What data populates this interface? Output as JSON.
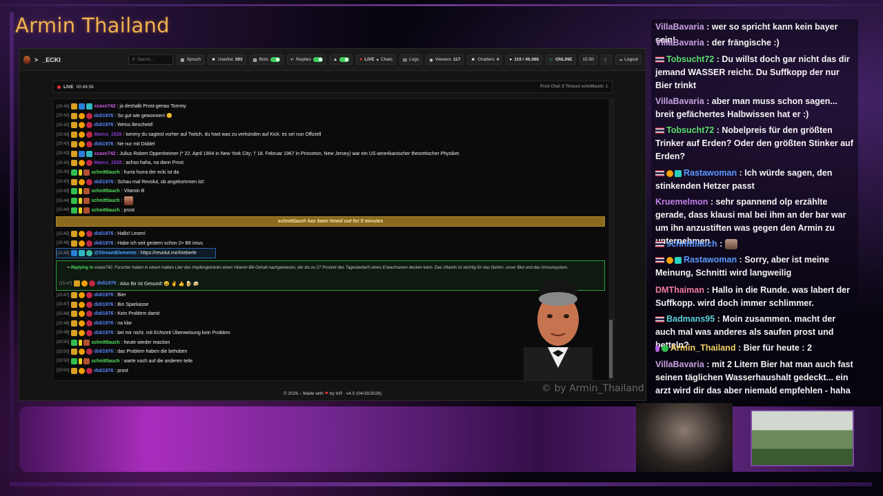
{
  "overlay": {
    "channel_title": "Armin Thailand",
    "watermark": "© by Armin_Thailand"
  },
  "app": {
    "brand": "_ECKI",
    "search_placeholder": "Search...",
    "toolbar": {
      "spruch": "Spruch",
      "userlist": "Userlist",
      "userlist_count": "393",
      "bots": "Bots",
      "replies": "Replies",
      "live": "LIVE",
      "chats": "Chats",
      "logs": "Logs",
      "viewers": "Viewers",
      "viewers_count": "117",
      "chatters": "Chatters",
      "chatters_count": "4",
      "messages": "119 / 46.986",
      "online": "ONLINE",
      "time": "15:50",
      "logout": "Logout"
    },
    "status": {
      "live": "LIVE",
      "duration": "00:49:58",
      "right": "Prost Chat: 8  Timeout schnittlauch: 1"
    },
    "footer": {
      "before": "© 2026 – Made with",
      "after": "by tcR · v4.0 (04/16/2026)"
    }
  },
  "chat": {
    "messages": [
      {
        "ts": "[15:40]",
        "user": "xxaxe742",
        "cls": "u-xx",
        "badges": [
          "b-crown",
          "b-blue",
          "b-cyan"
        ],
        "text": ": ja deshalb Prost-genau Tommy"
      },
      {
        "ts": "[15:42]",
        "user": "didi1976",
        "cls": "u-didi",
        "badges": [
          "b-crown",
          "b-coin",
          "b-flower"
        ],
        "text": ": So gut wie gewonnen! 😊"
      },
      {
        "ts": "[15:42]",
        "user": "didi1976",
        "cls": "u-didi",
        "badges": [
          "b-crown",
          "b-coin",
          "b-flower"
        ],
        "text": ": Weiss Bescheid!"
      },
      {
        "ts": "[15:43]",
        "user": "Marco_1928",
        "cls": "u-marco",
        "badges": [
          "b-crown",
          "b-coin",
          "b-flower"
        ],
        "text": ": tommy du sagtest vorher auf Twitch, du hast was zu verkünden auf Kick. es sei nun Offiziell"
      },
      {
        "ts": "[15:43]",
        "user": "didi1976",
        "cls": "u-didi",
        "badges": [
          "b-crown",
          "b-coin",
          "b-flower"
        ],
        "text": ": Ne nur mit Diddel"
      },
      {
        "ts": "[15:43]",
        "user": "xxaxe742",
        "cls": "u-xx",
        "badges": [
          "b-crown",
          "b-blue",
          "b-cyan"
        ],
        "text": ": Julius Robert Oppenheimer (* 22. April 1904 in New York City; † 18. Februar 1967 in Princeton, New Jersey) war ein US-amerikanischer theoretischer Physiker."
      },
      {
        "ts": "[15:43]",
        "user": "Marco_1928",
        "cls": "u-marco",
        "badges": [
          "b-crown",
          "b-coin",
          "b-flower"
        ],
        "text": ": achso haha, na dann Prost"
      },
      {
        "ts": "[15:43]",
        "user": "schnittlauch",
        "cls": "u-schnitt",
        "badges": [
          "b-green",
          "b-yellow",
          "b-bear"
        ],
        "text": ": hurra hurra der ecki ist da"
      },
      {
        "ts": "[15:43]",
        "user": "didi1976",
        "cls": "u-didi",
        "badges": [
          "b-crown",
          "b-coin",
          "b-flower"
        ],
        "text": ": Schau mal Revolut, ob angekommen ist!"
      },
      {
        "ts": "[15:43]",
        "user": "schnittlauch",
        "cls": "u-schnitt",
        "badges": [
          "b-green",
          "b-yellow",
          "b-bear"
        ],
        "text": ": Vitamin B"
      },
      {
        "ts": "[15:44]",
        "user": "schnittlauch",
        "cls": "u-schnitt",
        "badges": [
          "b-green",
          "b-yellow",
          "b-bear"
        ],
        "text": ":",
        "emote": true
      },
      {
        "ts": "[15:44]",
        "user": "schnittlauch",
        "cls": "u-schnitt",
        "badges": [
          "b-green",
          "b-yellow",
          "b-bear"
        ],
        "text": ": prost"
      }
    ],
    "timeout_notice": "schnittlauch has been timed out for 5 minutes",
    "messages2": [
      {
        "ts": "[15:45]",
        "user": "didi1976",
        "cls": "u-didi",
        "badges": [
          "b-crown",
          "b-coin",
          "b-flower"
        ],
        "text": ": Hallo! Lesen!"
      },
      {
        "ts": "[15:46]",
        "user": "didi1976",
        "cls": "u-didi",
        "badges": [
          "b-crown",
          "b-coin",
          "b-flower"
        ],
        "text": ": Habe ich seit gestern schon 2× B6 intus."
      }
    ],
    "streamelements": {
      "ts": "[15:46]",
      "user": "@StreamElements",
      "text": ": https://revolut.me/trieberle"
    },
    "reply": {
      "label": "Replying to",
      "to": "xxaxe742:",
      "quote": "Forscher haben in einem halben Liter des Hopfengetränks einen Vitamin-B6-Gehalt nachgewiesen, der bis zu 27 Prozent des Tagesbedarfs eines Erwachsenen decken kann. Das Vitamin ist wichtig für das Gehirn, unser Blut und das Immunsystem.",
      "ts": "[15:47]",
      "user": "didi1976",
      "text": ": Also Bir ist Gesund! 😆 ✌ 👍 🍺 🍻"
    },
    "messages3": [
      {
        "ts": "[15:47]",
        "user": "didi1976",
        "cls": "u-didi",
        "badges": [
          "b-crown",
          "b-coin",
          "b-flower"
        ],
        "text": ": Bier"
      },
      {
        "ts": "[15:47]",
        "user": "didi1976",
        "cls": "u-didi",
        "badges": [
          "b-crown",
          "b-coin",
          "b-flower"
        ],
        "text": ": Bin Sparkasse"
      },
      {
        "ts": "[15:48]",
        "user": "didi1976",
        "cls": "u-didi",
        "badges": [
          "b-crown",
          "b-coin",
          "b-flower"
        ],
        "text": ": Kein Problem damit"
      },
      {
        "ts": "[15:49]",
        "user": "didi1976",
        "cls": "u-didi",
        "badges": [
          "b-crown",
          "b-coin",
          "b-flower"
        ],
        "text": ": na klar"
      },
      {
        "ts": "[15:49]",
        "user": "didi1976",
        "cls": "u-didi",
        "badges": [
          "b-crown",
          "b-coin",
          "b-flower"
        ],
        "text": ": bei mir nicht. mit Echtzeit Überweisung kein Problem"
      },
      {
        "ts": "[15:50]",
        "user": "schnittlauch",
        "cls": "u-schnitt",
        "badges": [
          "b-green",
          "b-yellow",
          "b-bear"
        ],
        "text": ": heute wieder reaction"
      },
      {
        "ts": "[15:50]",
        "user": "didi1976",
        "cls": "u-didi",
        "badges": [
          "b-crown",
          "b-coin",
          "b-flower"
        ],
        "text": ": das Problem haben die behoben"
      },
      {
        "ts": "[15:50]",
        "user": "schnittlauch",
        "cls": "u-schnitt",
        "badges": [
          "b-green",
          "b-yellow",
          "b-bear"
        ],
        "text": ": warte noch auf die anderen teile"
      },
      {
        "ts": "[15:50]",
        "user": "didi1976",
        "cls": "u-didi",
        "badges": [
          "b-crown",
          "b-coin",
          "b-flower"
        ],
        "text": ": prost"
      }
    ]
  },
  "side_chat": [
    {
      "badges": [],
      "user": "VillaBavaria",
      "color": "#c8a2e0",
      "text": " : wer so spricht kann kein bayer sein!"
    },
    {
      "badges": [],
      "user": "VillaBavaria",
      "color": "#c8a2e0",
      "text": " : der frängische :)"
    },
    {
      "badges": [
        "flag"
      ],
      "user": "Tobsucht72",
      "color": "#5ae06a",
      "text": " : Du willst doch gar nicht das dir jemand WASSER reicht. Du Suffkopp der nur Bier trinkt"
    },
    {
      "badges": [],
      "user": "VillaBavaria",
      "color": "#c8a2e0",
      "text": " : aber man muss schon sagen... breit gefächertes Halbwissen hat er :)"
    },
    {
      "badges": [
        "flag"
      ],
      "user": "Tobsucht72",
      "color": "#5ae06a",
      "text": " : Nobelpreis für den größten Trinker auf Erden? Oder den größten Stinker auf Erden?"
    },
    {
      "badges": [
        "flag",
        "coin",
        "gift"
      ],
      "user": "Rastawoman",
      "color": "#5a9aff",
      "text": " : Ich würde sagen, den stinkenden Hetzer passt"
    },
    {
      "badges": [],
      "user": "Kruemelmon",
      "color": "#c080e8",
      "text": " : sehr spannend olp erzählte gerade, dass klausi mal bei ihm an der bar war um ihn anzustiften was gegen den Armin zu unternehmen"
    },
    {
      "badges": [
        "flag"
      ],
      "user": "schnittlauch",
      "color": "#5a9aff",
      "text": " :",
      "emote": true
    },
    {
      "badges": [
        "flag",
        "coin",
        "gift"
      ],
      "user": "Rastawoman",
      "color": "#5a9aff",
      "text": " : Sorry, aber ist meine Meinung, Schnitti wird langweilig"
    },
    {
      "badges": [],
      "user": "DMThaiman",
      "color": "#f07aa0",
      "text": " : Hallo in die Runde. was labert der Suffkopp. wird doch immer schlimmer."
    },
    {
      "badges": [
        "flag"
      ],
      "user": "Badmans95",
      "color": "#5ad0d8",
      "text": " : Moin zusammen. macht der auch mal was anderes als saufen prost und betteln?"
    },
    {
      "badges": [
        "mic",
        "check"
      ],
      "user": "Armin_Thailand",
      "color": "#f0d060",
      "text": " : Bier für heute : 2"
    },
    {
      "badges": [],
      "user": "VillaBavaria",
      "color": "#c8a2e0",
      "text": " : mit 2 Litern Bier hat man auch fast seinen täglichen Wasserhaushalt gedeckt... ein arzt wird dir das aber niemald empfehlen - haha"
    }
  ]
}
